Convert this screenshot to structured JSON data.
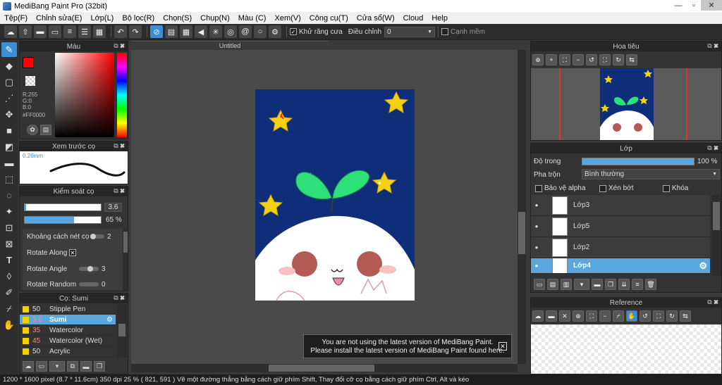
{
  "app": {
    "title": "MediBang Paint Pro (32bit)"
  },
  "menu": [
    "Tệp(F)",
    "Chỉnh sửa(E)",
    "Lớp(L)",
    "Bộ lọc(R)",
    "Chọn(S)",
    "Chụp(N)",
    "Màu (C)",
    "Xem(V)",
    "Công cụ(T)",
    "Cửa sổ(W)",
    "Cloud",
    "Help"
  ],
  "toolbar": {
    "antialias_label": "Khử răng cưa",
    "correction_label": "Điều chỉnh",
    "correction_value": "0",
    "edge_label": "Cạnh mềm"
  },
  "color_panel": {
    "title": "Màu",
    "r": "R:255",
    "g": "G:0",
    "b": "B:0",
    "hex": "#FF0000",
    "current_color": "#FF0000"
  },
  "preview_panel": {
    "title": "Xem trước cọ",
    "size_label": "0.26mm"
  },
  "control_panel": {
    "title": "Kiểm soát cọ",
    "size_value": "3.6",
    "size_fill": 0.02,
    "opacity_value": "65 %",
    "opacity_fill": 0.65,
    "rows": [
      {
        "label": "Khoảng cách nét cọ",
        "value": "2"
      },
      {
        "label": "Rotate Along",
        "value": ""
      },
      {
        "label": "Rotate Angle",
        "value": "3"
      },
      {
        "label": "Rotate Random",
        "value": "0"
      }
    ]
  },
  "brush_panel": {
    "title": "Cọ: Sumi",
    "brushes": [
      {
        "size": "50",
        "name": "Stipple Pen",
        "color": "#F5D000",
        "selected": false
      },
      {
        "size": "3.6",
        "name": "Sumi",
        "color": "#F5D000",
        "selected": true
      },
      {
        "size": "35",
        "name": "Watercolor",
        "color": "#F5D000",
        "selected": false
      },
      {
        "size": "45",
        "name": "Watercolor (Wet)",
        "color": "#F5D000",
        "selected": false
      },
      {
        "size": "50",
        "name": "Acrylic",
        "color": "#F5D000",
        "selected": false
      }
    ]
  },
  "document": {
    "tab": "Untitled"
  },
  "navigator": {
    "title": "Hoa tiêu"
  },
  "layer_panel": {
    "title": "Lớp",
    "opacity_label": "Độ trong",
    "opacity_value": "100 %",
    "opacity_fill": 1.0,
    "blend_label": "Pha trộn",
    "blend_value": "Bình thường",
    "protect_alpha": "Bảo vệ alpha",
    "clip": "Xén bớt",
    "lock": "Khóa",
    "layers": [
      {
        "name": "Lớp3",
        "selected": false
      },
      {
        "name": "Lớp5",
        "selected": false
      },
      {
        "name": "Lớp2",
        "selected": false
      },
      {
        "name": "Lớp4",
        "selected": true
      }
    ]
  },
  "reference_panel": {
    "title": "Reference"
  },
  "notice": {
    "line1": "You are not using the latest version of MediBang Paint.",
    "line2": "Please install the latest version of MediBang Paint found here."
  },
  "status": {
    "text": "1200 * 1600 pixel  (8.7 * 11.6cm)  350 dpi  25 %  ( 821, 591 )  Vẽ một đường thẳng bằng cách giữ phím Shift, Thay đổi cỡ cọ bằng cách giữ phím Ctrl, Alt và kéo"
  }
}
